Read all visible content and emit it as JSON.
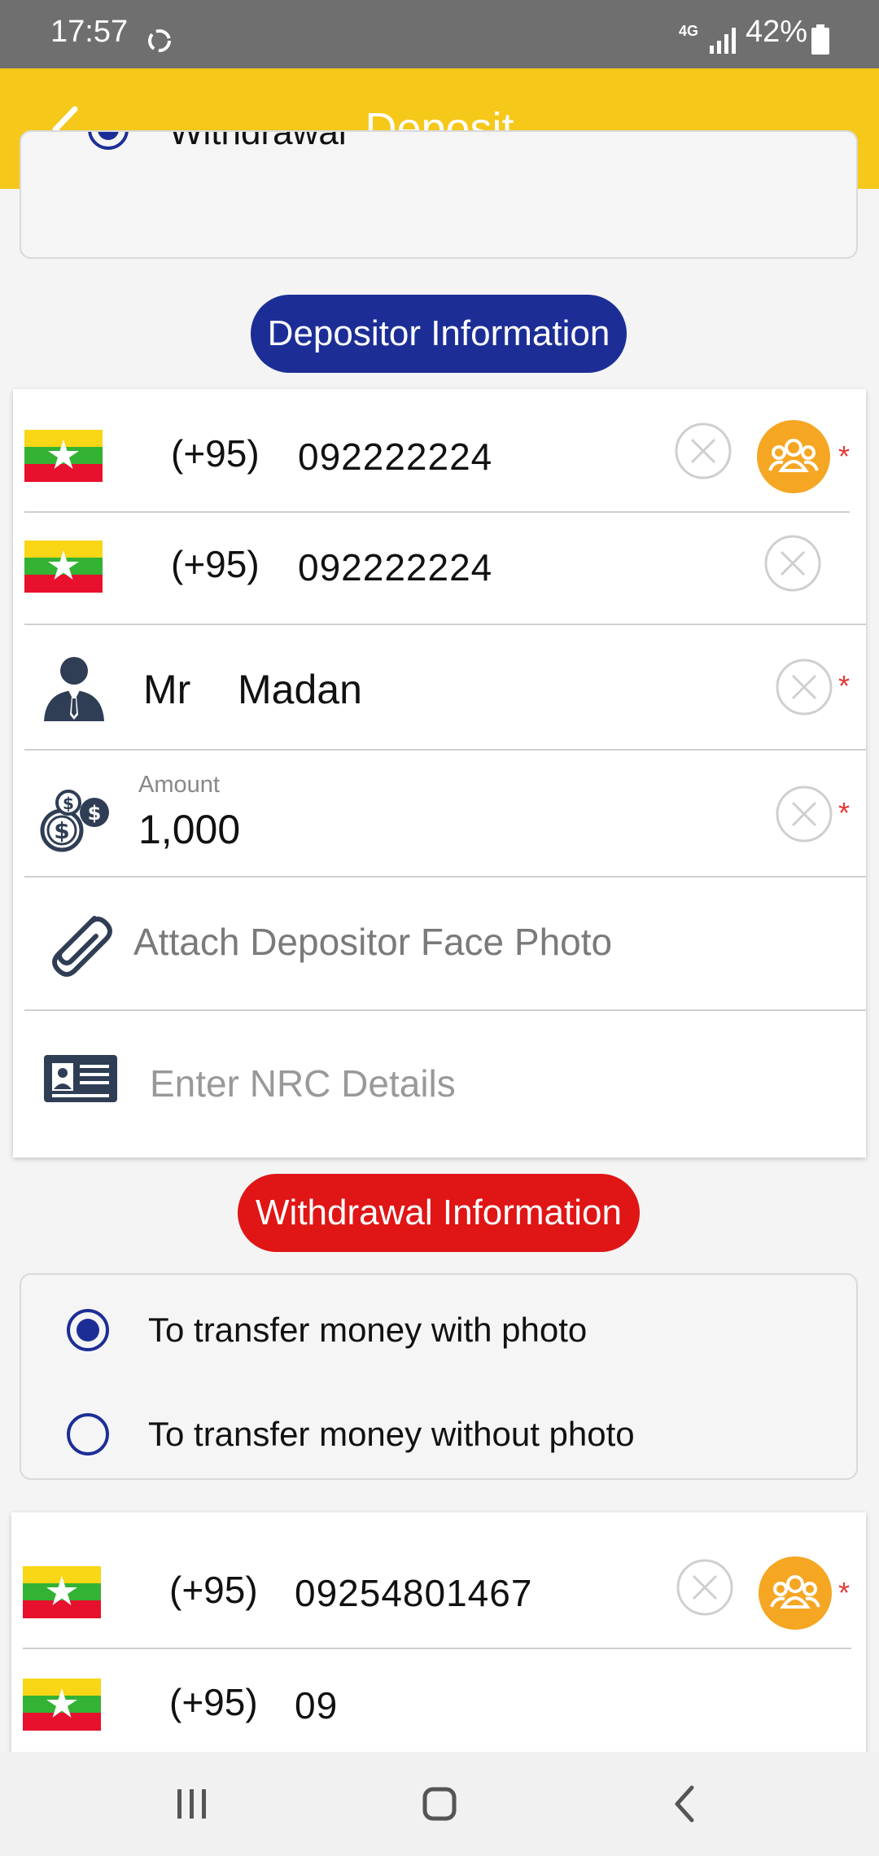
{
  "status_bar": {
    "time": "17:57",
    "network": "4G",
    "battery": "42%",
    "icons": [
      "sync-icon",
      "signal-icon",
      "battery-icon"
    ]
  },
  "app_bar": {
    "title": "Deposit",
    "background": "#f5c81a",
    "back_icon": "chevron-left-icon"
  },
  "top_section": {
    "radio_label": "Withdrawal"
  },
  "depositor": {
    "section_title": "Depositor Information",
    "pill_color": "#1c2e96",
    "phone_primary": {
      "code": "(+95)",
      "number": "092222224"
    },
    "phone_confirm": {
      "code": "(+95)",
      "number": "092222224"
    },
    "name": {
      "title": "Mr",
      "value": "Madan"
    },
    "amount": {
      "label": "Amount",
      "value": "1,000"
    },
    "attach_face_photo": "Attach Depositor Face Photo",
    "nrc_placeholder": "Enter NRC Details",
    "required_mark": "*"
  },
  "withdrawal": {
    "section_title": "Withdrawal Information",
    "pill_color": "#e01515",
    "options": [
      {
        "label": "To transfer money with photo",
        "selected": true
      },
      {
        "label": "To transfer money without photo",
        "selected": false
      }
    ],
    "phone_primary": {
      "code": "(+95)",
      "number": "09254801467"
    },
    "phone_confirm": {
      "code": "(+95)",
      "number": "09"
    }
  },
  "nav_bar": {
    "buttons": [
      "recent-apps-icon",
      "home-icon",
      "back-icon"
    ]
  },
  "colors": {
    "accent_yellow": "#f5c81a",
    "contact_orange": "#f5a623",
    "required_red": "#e53935",
    "radio_blue": "#1c2e96"
  }
}
